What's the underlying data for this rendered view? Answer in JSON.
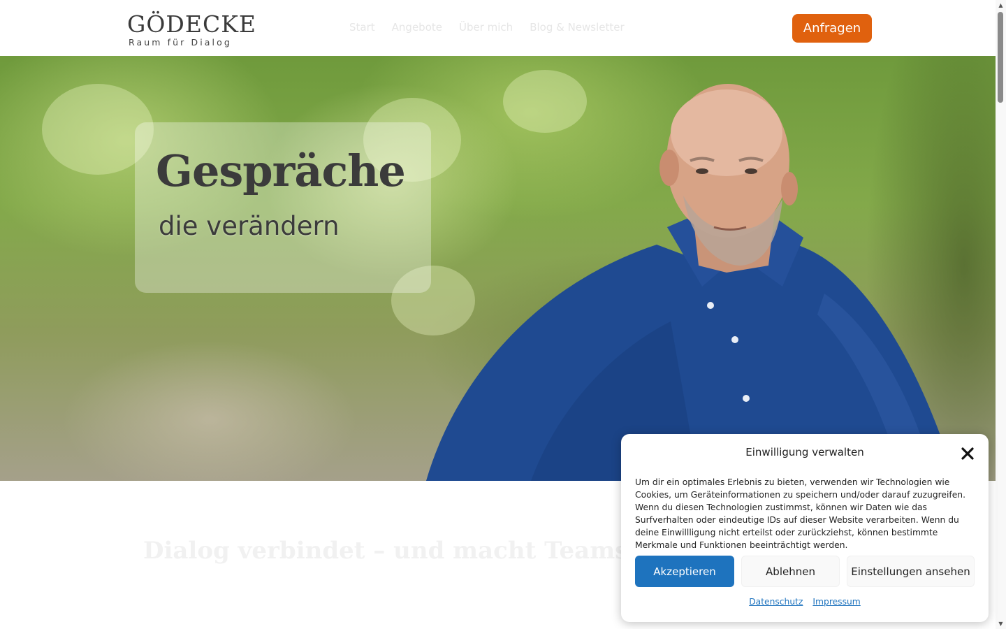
{
  "header": {
    "logo_main": "GÖDECKE",
    "logo_sub": "Raum für Dialog",
    "nav": [
      "Start",
      "Angebote",
      "Über mich",
      "Blog & Newsletter"
    ],
    "cta_label": "Anfragen"
  },
  "hero": {
    "title": "Gespräche",
    "subtitle": "die verändern"
  },
  "intro": {
    "heading": "Dialog verbindet – und macht Teams stärker"
  },
  "cookie": {
    "title": "Einwilligung verwalten",
    "text": "Um dir ein optimales Erlebnis zu bieten, verwenden wir Technologien wie Cookies, um Geräteinformationen zu speichern und/oder darauf zuzugreifen. Wenn du diesen Technologien zustimmst, können wir Daten wie das Surfverhalten oder eindeutige IDs auf dieser Website verarbeiten. Wenn du deine Einwillligung nicht erteilst oder zurückziehst, können bestimmte Merkmale und Funktionen beeinträchtigt werden.",
    "accept_label": "Akzeptieren",
    "decline_label": "Ablehnen",
    "settings_label": "Einstellungen ansehen",
    "privacy_link": "Datenschutz",
    "imprint_link": "Impressum"
  },
  "colors": {
    "accent_orange": "#e0610e",
    "accent_blue": "#1e73be",
    "shirt_blue": "#1f4a91"
  },
  "icons": {
    "close": "close-icon",
    "scroll_up": "scroll-up-arrow-icon",
    "scroll_down": "scroll-down-arrow-icon"
  }
}
